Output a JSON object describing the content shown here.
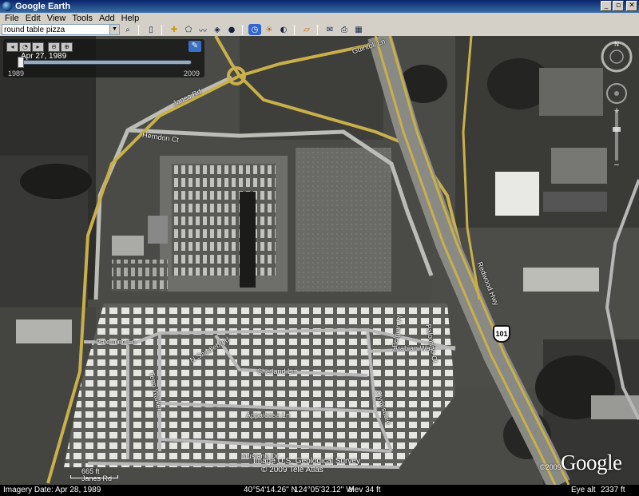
{
  "window": {
    "title": "Google Earth",
    "minimize": "_",
    "maximize": "▫",
    "close": "✕"
  },
  "menu": [
    "File",
    "Edit",
    "View",
    "Tools",
    "Add",
    "Help"
  ],
  "toolbar": {
    "search_value": "round table pizza",
    "dropdown": "▼"
  },
  "time_slider": {
    "date": "Apr 27, 1989",
    "start_year": "1989",
    "end_year": "2009",
    "position_fraction": 0.0
  },
  "road_labels": {
    "guntoyle": "Guintoli Ln",
    "janes_rd": "Janes Rd",
    "herndon": "Herndon Ct",
    "redwood_hwy": "Redwood Hwy",
    "palomino": "Palomino Ln",
    "n_saddlebred": "N Saddlebred",
    "shetland": "Shetland Ln",
    "arabian": "Arabian Way",
    "bay_belgian": "Belgian Pl",
    "pinto": "Palomino Ct",
    "appaloosa": "Appaloosa Ln",
    "mustang": "Mustang Dr",
    "janes_bottom": "Janes Rd",
    "tenn_walker": "Tenn Walker",
    "clydesdale": "Clydesdale"
  },
  "highway_shield": "101",
  "attribution": {
    "line1": "Image U.S. Geological Survey",
    "line2": "© 2009 Tele Atlas",
    "copyright": "©2009"
  },
  "logo": "Google",
  "scale": "665 ft",
  "status": {
    "imagery_date": "Imagery Date: Apr 28, 1989",
    "lat": "40°54'14.26\" N",
    "lon": "124°05'32.12\" W",
    "elev": "elev  34 ft",
    "eye_label": "Eye alt",
    "eye_value": "2337 ft"
  },
  "colors": {
    "road": "#d8c25a",
    "street": "#b8b8b8",
    "title_bar": "#0a246a"
  },
  "icons": [
    "search-icon",
    "sidebar-icon",
    "placemark-icon",
    "polygon-icon",
    "path-icon",
    "image-overlay-icon",
    "record-tour-icon",
    "historical-imagery-icon",
    "sun-icon",
    "planets-icon",
    "ruler-icon",
    "email-icon",
    "print-icon",
    "view-in-maps-icon"
  ]
}
